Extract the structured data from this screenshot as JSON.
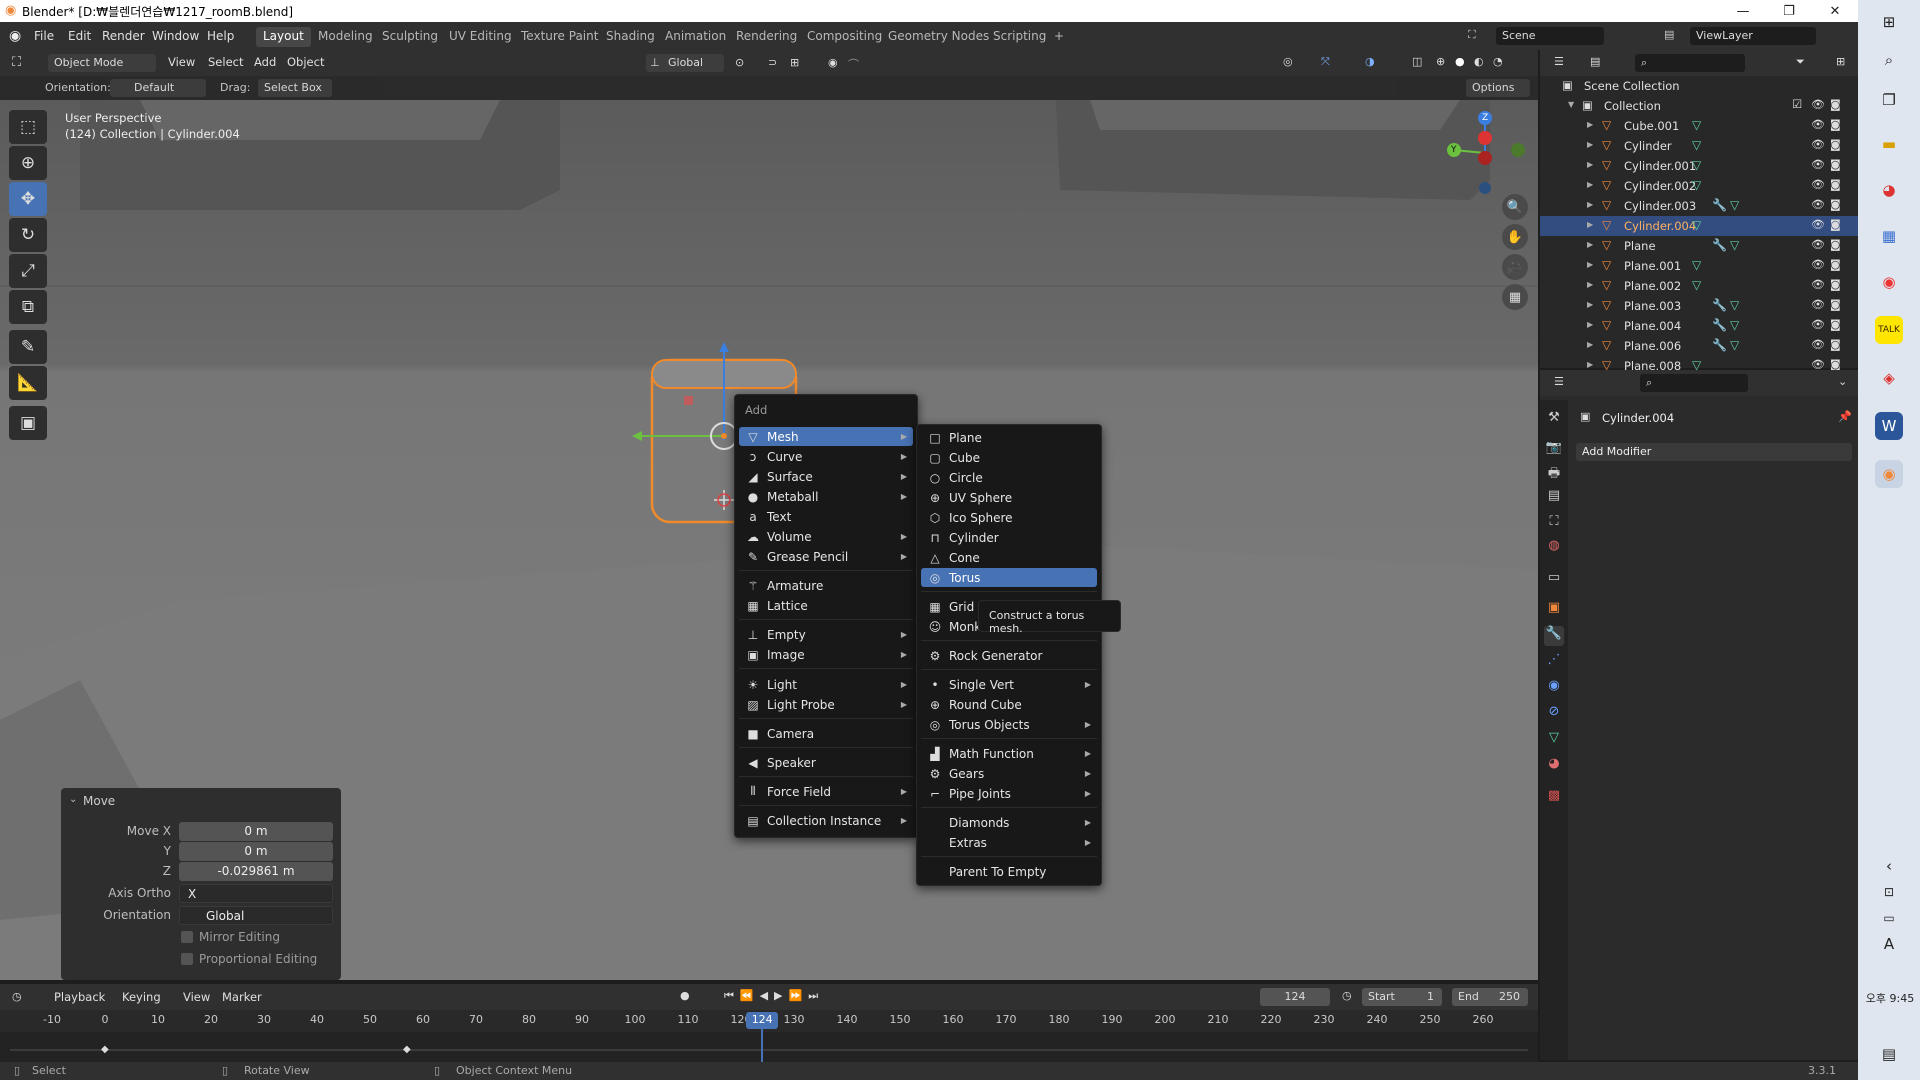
{
  "window": {
    "title": "Blender* [D:₩블렌더연습₩1217_roomB.blend]",
    "minimize": "—",
    "restore": "❐",
    "close": "✕"
  },
  "menubar": {
    "items": [
      "File",
      "Edit",
      "Render",
      "Window",
      "Help"
    ],
    "workspaces": [
      "Layout",
      "Modeling",
      "Sculpting",
      "UV Editing",
      "Texture Paint",
      "Shading",
      "Animation",
      "Rendering",
      "Compositing",
      "Geometry Nodes",
      "Scripting"
    ],
    "add_tab": "+",
    "scene": "Scene",
    "view_layer": "ViewLayer"
  },
  "viewport_header": {
    "mode": "Object Mode",
    "menus": [
      "View",
      "Select",
      "Add",
      "Object"
    ],
    "transform_orientation": "Global"
  },
  "tool_settings": {
    "orientation_label": "Orientation:",
    "orientation_value": "Default",
    "drag_label": "Drag:",
    "drag_value": "Select Box",
    "options": "Options"
  },
  "viewport": {
    "perspective": "User Perspective",
    "collection_info": "(124) Collection | Cylinder.004",
    "gizmo_axes": {
      "x": "X",
      "y": "Y",
      "z": "Z"
    }
  },
  "add_menu": {
    "title": "Add",
    "items": [
      {
        "label": "Mesh",
        "icon": "▽",
        "sub": true
      },
      {
        "label": "Curve",
        "icon": "ↄ",
        "sub": true
      },
      {
        "label": "Surface",
        "icon": "◢",
        "sub": true
      },
      {
        "label": "Metaball",
        "icon": "●",
        "sub": true
      },
      {
        "label": "Text",
        "icon": "a",
        "sub": false
      },
      {
        "label": "Volume",
        "icon": "☁",
        "sub": true
      },
      {
        "label": "Grease Pencil",
        "icon": "✎",
        "sub": true
      },
      {
        "label": "Armature",
        "icon": "⚚",
        "sub": false
      },
      {
        "label": "Lattice",
        "icon": "▦",
        "sub": false
      },
      {
        "label": "Empty",
        "icon": "⊥",
        "sub": true
      },
      {
        "label": "Image",
        "icon": "▣",
        "sub": true
      },
      {
        "label": "Light",
        "icon": "☀",
        "sub": true
      },
      {
        "label": "Light Probe",
        "icon": "▨",
        "sub": true
      },
      {
        "label": "Camera",
        "icon": "■",
        "sub": false
      },
      {
        "label": "Speaker",
        "icon": "◀",
        "sub": false
      },
      {
        "label": "Force Field",
        "icon": "⦀",
        "sub": true
      },
      {
        "label": "Collection Instance",
        "icon": "▤",
        "sub": true
      }
    ]
  },
  "mesh_menu": {
    "items": [
      {
        "label": "Plane",
        "icon": "□",
        "sub": false
      },
      {
        "label": "Cube",
        "icon": "▢",
        "sub": false
      },
      {
        "label": "Circle",
        "icon": "○",
        "sub": false
      },
      {
        "label": "UV Sphere",
        "icon": "⊕",
        "sub": false
      },
      {
        "label": "Ico Sphere",
        "icon": "⬡",
        "sub": false
      },
      {
        "label": "Cylinder",
        "icon": "⊓",
        "sub": false
      },
      {
        "label": "Cone",
        "icon": "△",
        "sub": false
      },
      {
        "label": "Torus",
        "icon": "◎",
        "sub": false
      },
      {
        "label": "Grid",
        "icon": "▦",
        "sub": false
      },
      {
        "label": "Monk",
        "icon": "☺",
        "sub": false
      },
      {
        "label": "Rock Generator",
        "icon": "⚙",
        "sub": false
      },
      {
        "label": "Single Vert",
        "icon": "•",
        "sub": true
      },
      {
        "label": "Round Cube",
        "icon": "⊕",
        "sub": false
      },
      {
        "label": "Torus Objects",
        "icon": "◎",
        "sub": true
      },
      {
        "label": "Math Function",
        "icon": "▟",
        "sub": true
      },
      {
        "label": "Gears",
        "icon": "⚙",
        "sub": true
      },
      {
        "label": "Pipe Joints",
        "icon": "⌐",
        "sub": true
      },
      {
        "label": "Diamonds",
        "icon": "",
        "sub": true
      },
      {
        "label": "Extras",
        "icon": "",
        "sub": true
      },
      {
        "label": "Parent To Empty",
        "icon": "",
        "sub": false
      }
    ]
  },
  "tooltip": "Construct a torus mesh.",
  "redo_panel": {
    "title": "Move",
    "move_x_label": "Move X",
    "move_x": "0 m",
    "y_label": "Y",
    "y": "0 m",
    "z_label": "Z",
    "z": "-0.029861 m",
    "axis_ortho_label": "Axis Ortho",
    "axis_ortho": "X",
    "orientation_label": "Orientation",
    "orientation": "Global",
    "mirror_editing": "Mirror Editing",
    "proportional_editing": "Proportional Editing"
  },
  "timeline": {
    "menus": [
      "Playback",
      "Keying",
      "View",
      "Marker"
    ],
    "current_frame": "124",
    "start_label": "Start",
    "start": "1",
    "end_label": "End",
    "end": "250",
    "ticks": [
      "-10",
      "0",
      "10",
      "20",
      "30",
      "40",
      "50",
      "60",
      "70",
      "80",
      "90",
      "100",
      "110",
      "120",
      "130",
      "140",
      "150",
      "160",
      "170",
      "180",
      "190",
      "200",
      "210",
      "220",
      "230",
      "240",
      "250",
      "260"
    ],
    "playhead": "124"
  },
  "statusbar": {
    "left": "Select",
    "middle": "Rotate View",
    "right": "Object Context Menu",
    "version": "3.3.1"
  },
  "outliner": {
    "root": "Scene Collection",
    "collection": "Collection",
    "rows": [
      {
        "name": "Cube.001",
        "selected": false
      },
      {
        "name": "Cylinder",
        "selected": false
      },
      {
        "name": "Cylinder.001",
        "selected": false
      },
      {
        "name": "Cylinder.002",
        "selected": false
      },
      {
        "name": "Cylinder.003",
        "selected": false
      },
      {
        "name": "Cylinder.004",
        "selected": true
      },
      {
        "name": "Plane",
        "selected": false
      },
      {
        "name": "Plane.001",
        "selected": false
      },
      {
        "name": "Plane.002",
        "selected": false
      },
      {
        "name": "Plane.003",
        "selected": false
      },
      {
        "name": "Plane.004",
        "selected": false
      },
      {
        "name": "Plane.006",
        "selected": false
      },
      {
        "name": "Plane.008",
        "selected": false
      }
    ]
  },
  "properties": {
    "object_name": "Cylinder.004",
    "add_modifier": "Add Modifier"
  },
  "taskbar": {
    "clock": "오후 9:45",
    "lang": "A"
  }
}
